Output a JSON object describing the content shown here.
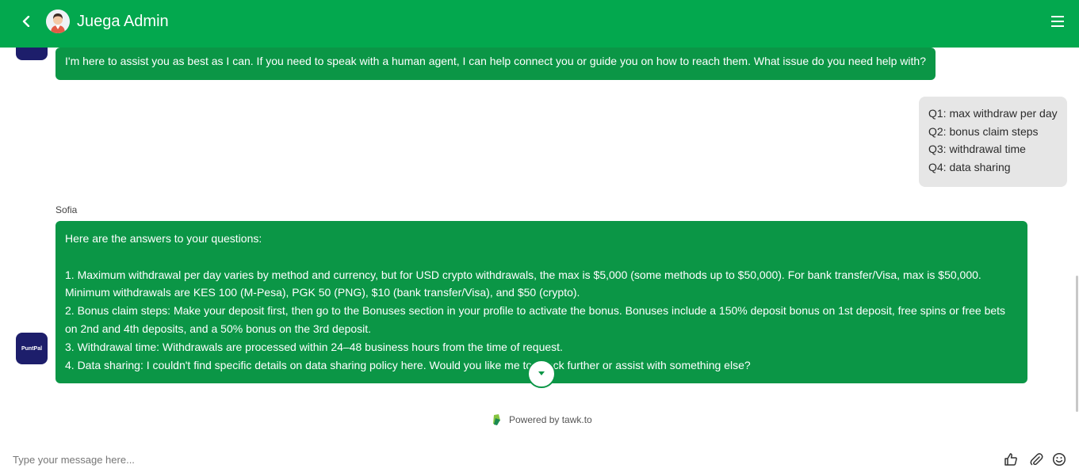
{
  "header": {
    "title": "Juega Admin"
  },
  "messages": {
    "agent1": {
      "text": "I'm here to assist you as best as I can. If you need to speak with a human agent, I can help connect you or guide you on how to reach them. What issue do you need help with?"
    },
    "user1": {
      "lines": [
        "Q1: max withdraw per day",
        "Q2: bonus claim steps",
        "Q3: withdrawal time",
        "Q4: data sharing"
      ]
    },
    "agent2": {
      "sender": "Sofia",
      "avatar_text": "PuntPal",
      "lines": [
        "Here are the answers to your questions:",
        "",
        "1. Maximum withdrawal per day varies by method and currency, but for USD crypto withdrawals, the max is $5,000 (some methods up to $50,000). For bank transfer/Visa, max is $50,000.",
        "Minimum withdrawals are KES 100 (M-Pesa), PGK 50 (PNG), $10 (bank transfer/Visa), and $50 (crypto).",
        "2. Bonus claim steps: Make your deposit first, then go to the Bonuses section in your profile to activate the bonus. Bonuses include a 150% deposit bonus on 1st deposit, free spins or free bets",
        "on 2nd and 4th deposits, and a 50% bonus on the 3rd deposit.",
        "3. Withdrawal time: Withdrawals are processed within 24–48 business hours from the time of request.",
        "4. Data sharing: I couldn't find specific details on data sharing policy here. Would you like me to check further or assist with something else?"
      ]
    }
  },
  "footer": {
    "powered_by": "Powered by tawk.to"
  },
  "composer": {
    "placeholder": "Type your message here..."
  },
  "colors": {
    "header": "#03a84e",
    "agent_bubble": "#0b9646",
    "user_bubble": "#e6e6e6",
    "agent_avatar_bg": "#1d1e6b"
  }
}
